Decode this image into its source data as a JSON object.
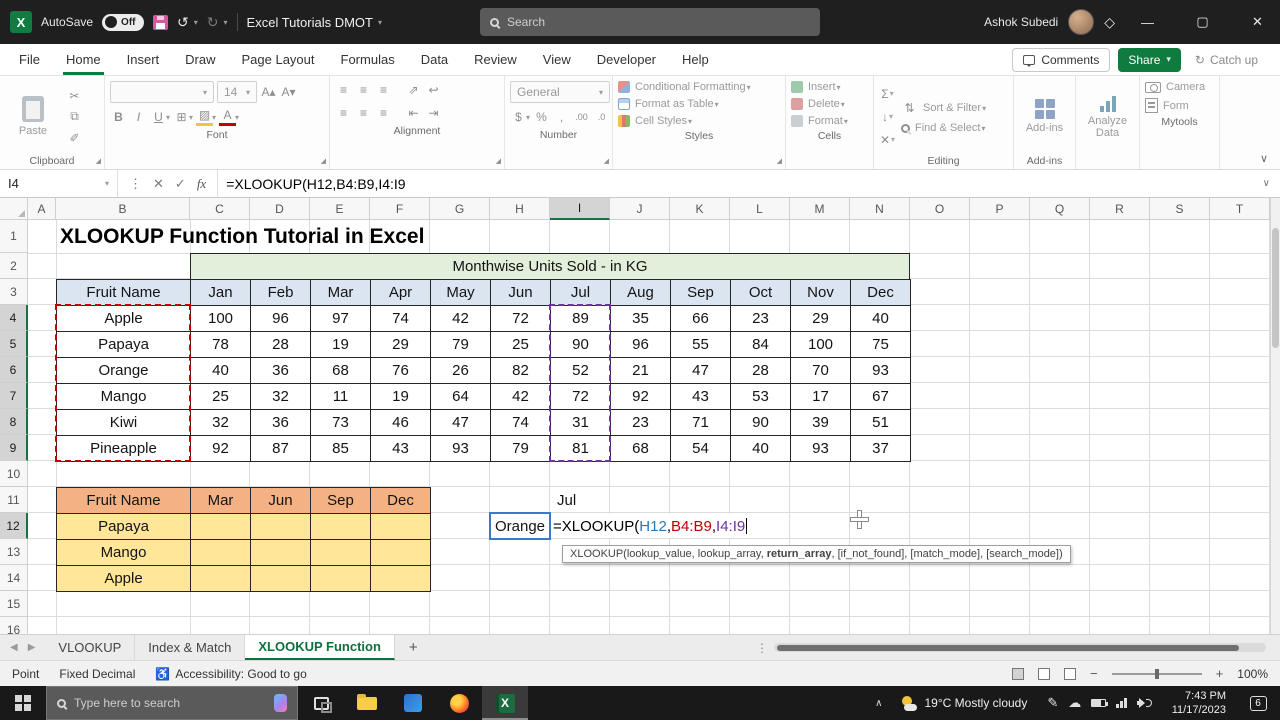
{
  "titlebar": {
    "autosave_label": "AutoSave",
    "autosave_state": "Off",
    "workbook_title": "Excel Tutorials DMOT",
    "search_placeholder": "Search",
    "user_name": "Ashok Subedi"
  },
  "menubar": {
    "items": [
      "File",
      "Home",
      "Insert",
      "Draw",
      "Page Layout",
      "Formulas",
      "Data",
      "Review",
      "View",
      "Developer",
      "Help"
    ],
    "active_item": "Home",
    "comments": "Comments",
    "share": "Share",
    "catch_up": "Catch up"
  },
  "ribbon": {
    "paste": "Paste",
    "font_size": "14",
    "number_format": "General",
    "styles": [
      "Conditional Formatting",
      "Format as Table",
      "Cell Styles"
    ],
    "cells": [
      "Insert",
      "Delete",
      "Format"
    ],
    "editing": [
      "Sort & Filter",
      "Find & Select"
    ],
    "addins": "Add-ins",
    "analyze": "Analyze Data",
    "mytools": [
      "Camera",
      "Form"
    ],
    "group_labels": [
      "Clipboard",
      "Font",
      "Alignment",
      "Number",
      "Styles",
      "Cells",
      "Editing",
      "Add-ins",
      "Mytools"
    ]
  },
  "formula_bar": {
    "name_box": "I4",
    "fx": "fx",
    "formula": "=XLOOKUP(H12,B4:B9,I4:I9"
  },
  "sheet": {
    "columns": [
      "A",
      "B",
      "C",
      "D",
      "E",
      "F",
      "G",
      "H",
      "I",
      "J",
      "K",
      "L",
      "M",
      "N",
      "O",
      "P",
      "Q",
      "R",
      "S",
      "T"
    ],
    "rows": [
      1,
      2,
      3,
      4,
      5,
      6,
      7,
      8,
      9,
      10,
      11,
      12,
      13,
      14,
      15,
      16
    ],
    "selection": {
      "column": "I",
      "rows": [
        4,
        5,
        6,
        7,
        8,
        9,
        12
      ]
    },
    "title": "XLOOKUP Function Tutorial in Excel",
    "table1": {
      "banner": "Monthwise Units Sold - in KG",
      "headers": [
        "Fruit Name",
        "Jan",
        "Feb",
        "Mar",
        "Apr",
        "May",
        "Jun",
        "Jul",
        "Aug",
        "Sep",
        "Oct",
        "Nov",
        "Dec"
      ],
      "rows": [
        {
          "name": "Apple",
          "values": [
            100,
            96,
            97,
            74,
            42,
            72,
            89,
            35,
            66,
            23,
            29,
            40
          ]
        },
        {
          "name": "Papaya",
          "values": [
            78,
            28,
            19,
            29,
            79,
            25,
            90,
            96,
            55,
            84,
            100,
            75
          ]
        },
        {
          "name": "Orange",
          "values": [
            40,
            36,
            68,
            76,
            26,
            82,
            52,
            21,
            47,
            28,
            70,
            93
          ]
        },
        {
          "name": "Mango",
          "values": [
            25,
            32,
            11,
            19,
            64,
            42,
            72,
            92,
            43,
            53,
            17,
            67
          ]
        },
        {
          "name": "Kiwi",
          "values": [
            32,
            36,
            73,
            46,
            47,
            74,
            31,
            23,
            71,
            90,
            39,
            51
          ]
        },
        {
          "name": "Pineapple",
          "values": [
            92,
            87,
            85,
            43,
            93,
            79,
            81,
            68,
            54,
            40,
            93,
            37
          ]
        }
      ]
    },
    "table2": {
      "headers": [
        "Fruit Name",
        "Mar",
        "Jun",
        "Sep",
        "Dec"
      ],
      "rows": [
        "Papaya",
        "Mango",
        "Apple"
      ]
    },
    "extra": {
      "i11": "Jul",
      "h12": "Orange",
      "formula_parts": [
        {
          "text": "=XLOOKUP(",
          "color": "#000000"
        },
        {
          "text": "H12",
          "color": "#2e75b6"
        },
        {
          "text": ",",
          "color": "#000000"
        },
        {
          "text": "B4:B9",
          "color": "#c00000"
        },
        {
          "text": ",",
          "color": "#000000"
        },
        {
          "text": "I4:I9",
          "color": "#7030a0"
        }
      ],
      "tooltip_parts": [
        {
          "text": "XLOOKUP(lookup_value, lookup_array, ",
          "bold": false
        },
        {
          "text": "return_array",
          "bold": true
        },
        {
          "text": ", [if_not_found], [match_mode], [search_mode])",
          "bold": false
        }
      ]
    }
  },
  "tabs": {
    "items": [
      "VLOOKUP",
      "Index & Match",
      "XLOOKUP Function"
    ],
    "active": "XLOOKUP Function"
  },
  "statusbar": {
    "mode": "Point",
    "fixed_decimal": "Fixed Decimal",
    "accessibility": "Accessibility: Good to go",
    "zoom": "100%"
  },
  "taskbar": {
    "search_placeholder": "Type here to search",
    "weather": "19°C  Mostly cloudy",
    "time": "7:43 PM",
    "date": "11/17/2023",
    "notification_count": "6"
  },
  "colors": {
    "excel_green": "#107c41",
    "share_green": "#0f7b3f",
    "ref_blue": "#2e75b6",
    "ref_red": "#c00000",
    "ref_purple": "#7030a0",
    "table_header_blue": "#dbe5f1",
    "banner_green": "#e2efda",
    "table2_header_orange": "#f4b183",
    "table2_yellow": "#ffe699"
  }
}
